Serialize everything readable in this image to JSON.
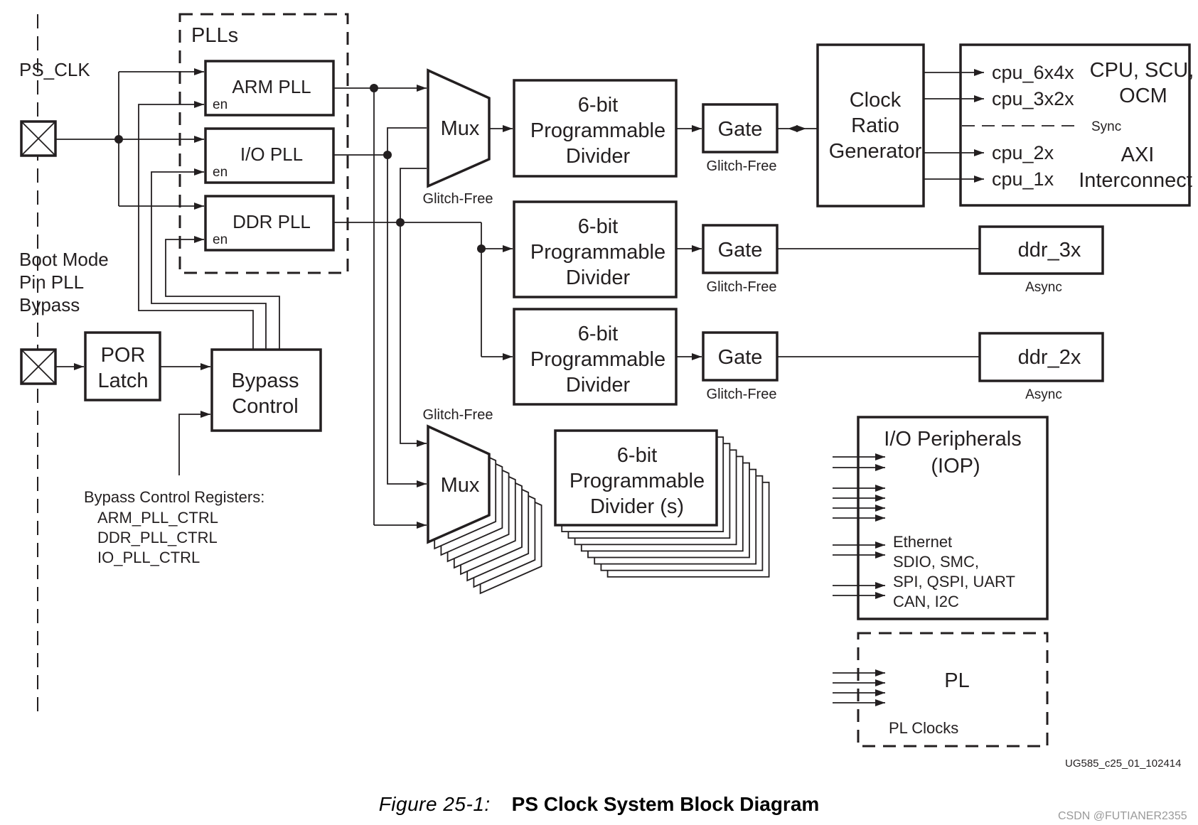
{
  "figure": {
    "number": "Figure 25-1:",
    "title": "PS Clock System Block Diagram",
    "id": "UG585_c25_01_102414",
    "watermark": "CSDN @FUTIANER2355"
  },
  "inputs": {
    "ps_clk": "PS_CLK",
    "boot_mode": [
      "Boot Mode",
      "Pin PLL",
      "Bypass"
    ]
  },
  "plls": {
    "group_label": "PLLs",
    "items": [
      {
        "name": "ARM PLL",
        "enable": "en"
      },
      {
        "name": "I/O PLL",
        "enable": "en"
      },
      {
        "name": "DDR PLL",
        "enable": "en"
      }
    ]
  },
  "por_latch": [
    "POR",
    "Latch"
  ],
  "bypass_control": [
    "Bypass",
    "Control"
  ],
  "bypass_registers": {
    "heading": "Bypass Control Registers:",
    "items": [
      "ARM_PLL_CTRL",
      "DDR_PLL_CTRL",
      "IO_PLL_CTRL"
    ]
  },
  "mux": {
    "label": "Mux",
    "note": "Glitch-Free"
  },
  "divider": [
    "6-bit",
    "Programmable",
    "Divider"
  ],
  "divider_multi": [
    "6-bit",
    "Programmable",
    "Divider (s)"
  ],
  "gate": {
    "label": "Gate",
    "note": "Glitch-Free"
  },
  "clock_ratio_generator": [
    "Clock",
    "Ratio",
    "Generator"
  ],
  "cpu_domain": {
    "clocks": [
      "cpu_6x4x",
      "cpu_3x2x",
      "cpu_2x",
      "cpu_1x"
    ],
    "upper_label": [
      "CPU, SCU,",
      "OCM"
    ],
    "sync_label": "Sync",
    "lower_label": [
      "AXI",
      "Interconnect"
    ]
  },
  "ddr_clocks": [
    {
      "name": "ddr_3x",
      "note": "Async"
    },
    {
      "name": "ddr_2x",
      "note": "Async"
    }
  ],
  "iop": {
    "title": [
      "I/O Peripherals",
      "(IOP)"
    ],
    "list": [
      "Ethernet",
      "SDIO, SMC,",
      "SPI, QSPI, UART",
      "CAN, I2C"
    ]
  },
  "pl": {
    "title": "PL",
    "clocks_label": "PL Clocks"
  },
  "colors": {
    "ink": "#231f20",
    "watermark": "#9a9a9a"
  }
}
